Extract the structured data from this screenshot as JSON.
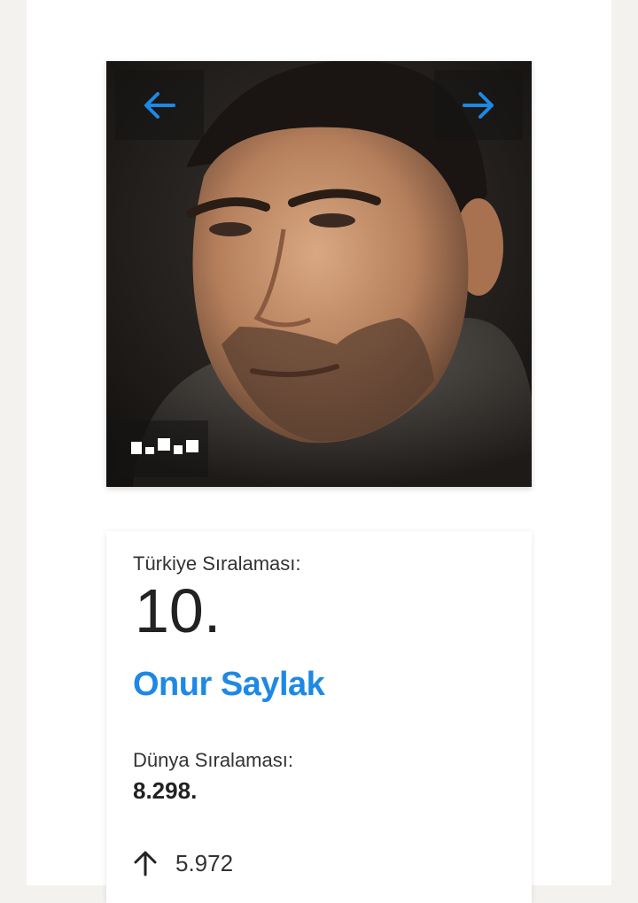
{
  "gallery": {
    "prev_icon": "arrow-left-icon",
    "next_icon": "arrow-right-icon",
    "accent": "#1e88e5"
  },
  "ranking": {
    "turkey_label": "Türkiye Sıralaması:",
    "turkey_rank": "10.",
    "name": "Onur Saylak",
    "world_label": "Dünya Sıralaması:",
    "world_rank": "8.298.",
    "change_icon": "arrow-up-icon",
    "change_value": "5.972"
  },
  "colors": {
    "name": "#1e88e5",
    "text": "#222222",
    "background": "#f3f2ef"
  }
}
